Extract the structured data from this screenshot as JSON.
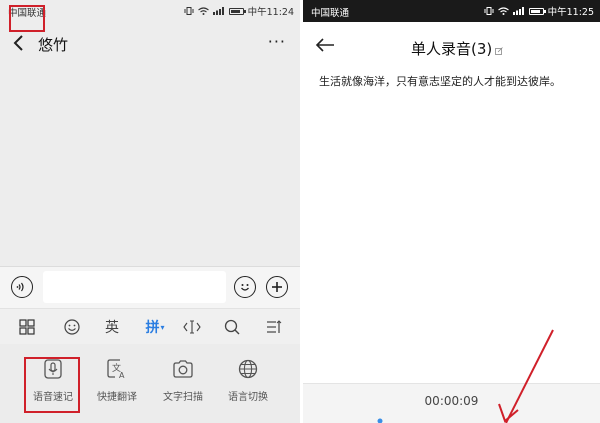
{
  "left": {
    "status": {
      "carrier": "中国联通",
      "time": "中午11:24",
      "battery_level": 0.85
    },
    "chat": {
      "title": "悠竹",
      "more": "···"
    },
    "input": {
      "placeholder": ""
    },
    "keyboard": {
      "en": "英",
      "pin": "拼",
      "pin_caret": "▾"
    },
    "tools": [
      {
        "label": "语音速记",
        "icon": "voice-note-icon"
      },
      {
        "label": "快捷翻译",
        "icon": "translate-icon"
      },
      {
        "label": "文字扫描",
        "icon": "camera-icon"
      },
      {
        "label": "语言切换",
        "icon": "globe-icon"
      }
    ],
    "colors": {
      "highlight": "#d0202a",
      "accent": "#2a7de1"
    }
  },
  "right": {
    "status": {
      "carrier": "中国联通",
      "time": "中午11:25",
      "battery_level": 0.85
    },
    "note": {
      "title": "单人录音(3)",
      "body": "生活就像海洋，只有意志坚定的人才能到达彼岸。",
      "timer": "00:00:09"
    }
  }
}
